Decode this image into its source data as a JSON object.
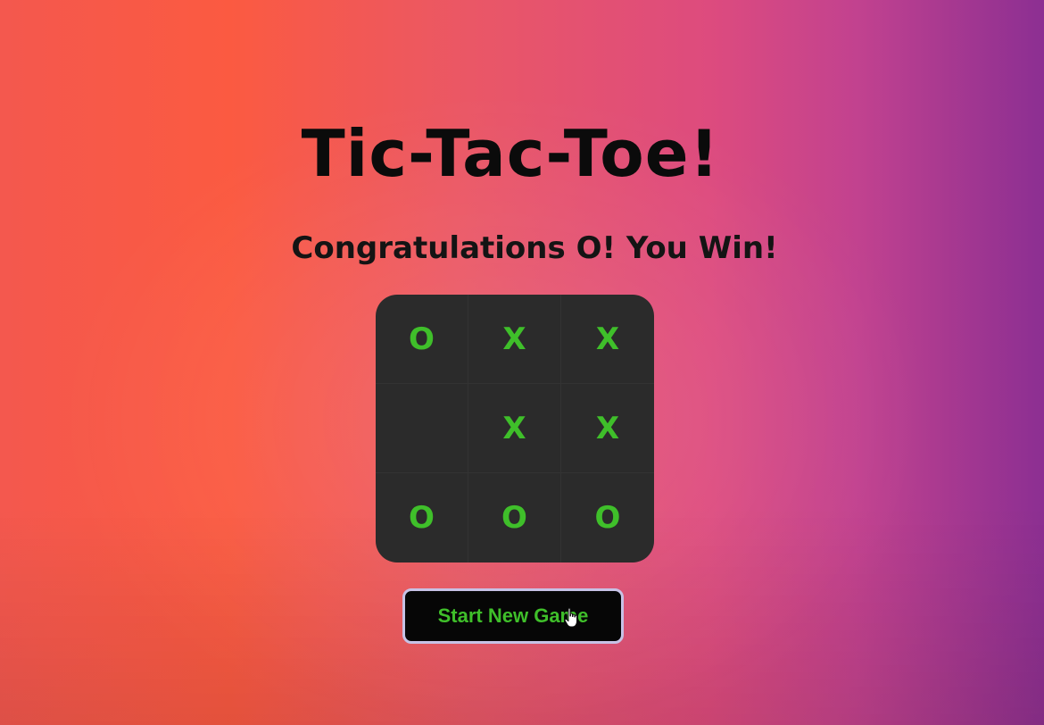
{
  "game": {
    "title": "Tic-Tac-Toe!",
    "status": "Congratulations O! You Win!",
    "board": [
      [
        "O",
        "X",
        "X"
      ],
      [
        "",
        "X",
        "X"
      ],
      [
        "O",
        "O",
        "O"
      ]
    ],
    "button_label": "Start New Game"
  },
  "colors": {
    "mark": "#3fbf2a",
    "board_bg": "#2b2b2b",
    "button_bg": "#060606",
    "button_border": "#c7c2e6"
  },
  "icons": {
    "cursor": "hand-pointer-icon"
  }
}
